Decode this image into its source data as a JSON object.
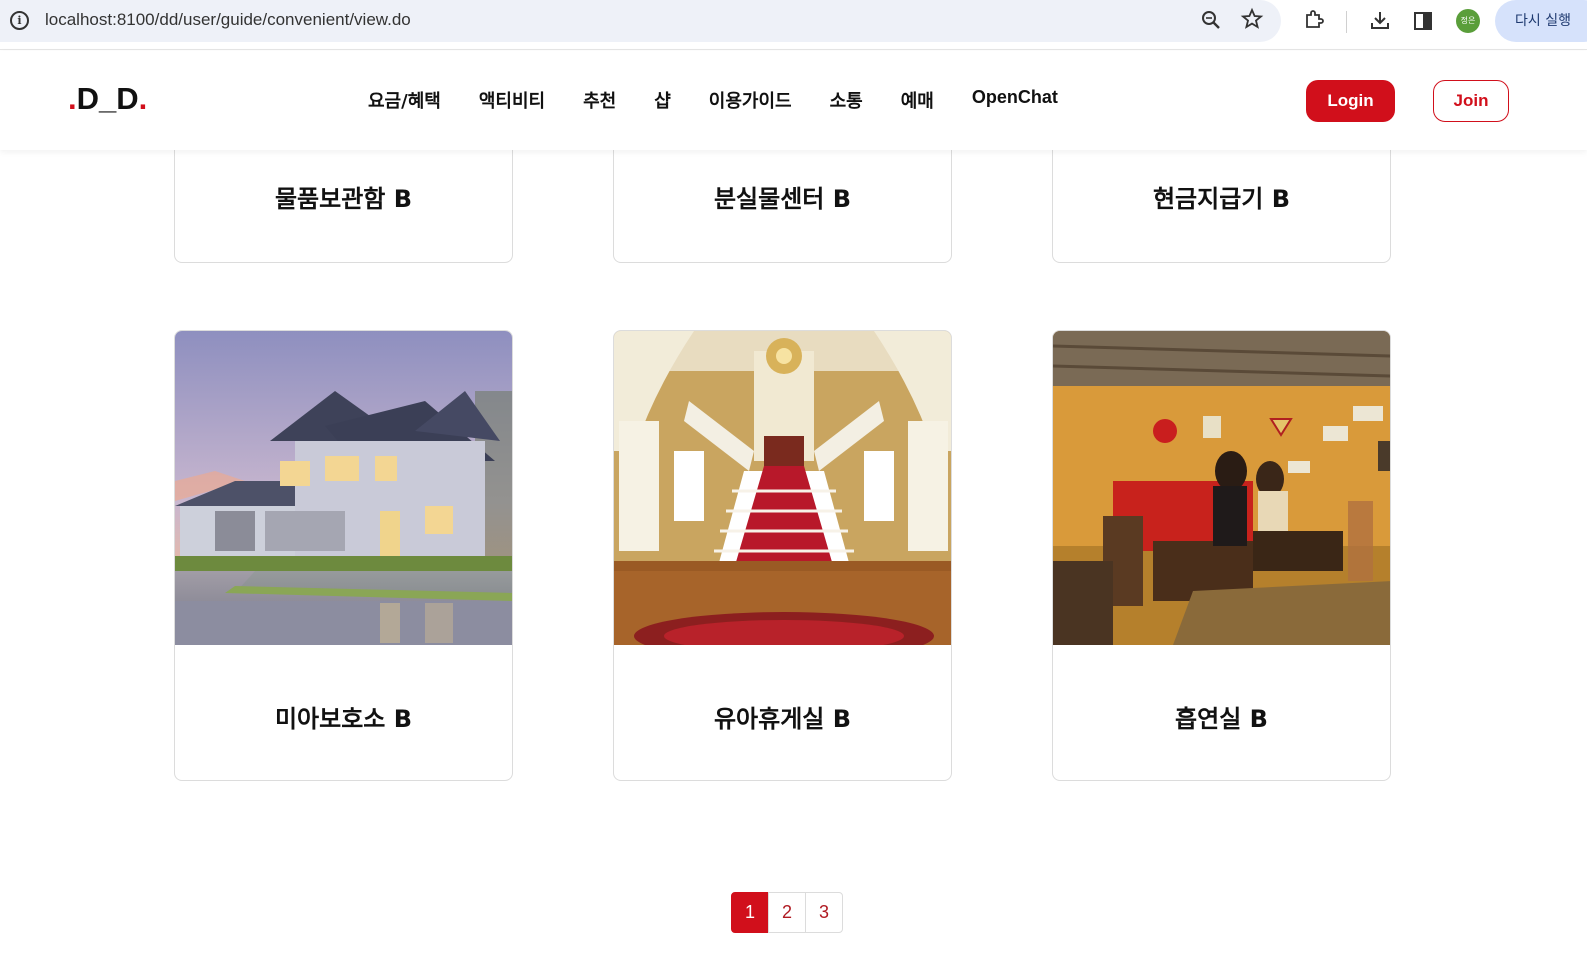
{
  "browser": {
    "url": "localhost:8100/dd/user/guide/convenient/view.do",
    "profile_initials": "정은",
    "relaunch_label": "다시 실행"
  },
  "header": {
    "logo": {
      "dot_left": ".",
      "text": "D_D",
      "dot_right": "."
    },
    "nav": [
      "요금/혜택",
      "액티비티",
      "추천",
      "샵",
      "이용가이드",
      "소통",
      "예매",
      "OpenChat"
    ],
    "login_label": "Login",
    "join_label": "Join"
  },
  "cards_top": [
    {
      "title": "물품보관함 B"
    },
    {
      "title": "분실물센터 B"
    },
    {
      "title": "현금지급기 B"
    }
  ],
  "cards_bottom": [
    {
      "title": "미아보호소 B",
      "image": "house-photo"
    },
    {
      "title": "유아휴게실 B",
      "image": "staircase-photo"
    },
    {
      "title": "흡연실 B",
      "image": "cafe-photo"
    }
  ],
  "pagination": {
    "pages": [
      "1",
      "2",
      "3"
    ],
    "current": "1"
  },
  "colors": {
    "accent": "#d10f1b",
    "card_border": "#dcdcdc",
    "omnibox_bg": "#eef1f8"
  }
}
